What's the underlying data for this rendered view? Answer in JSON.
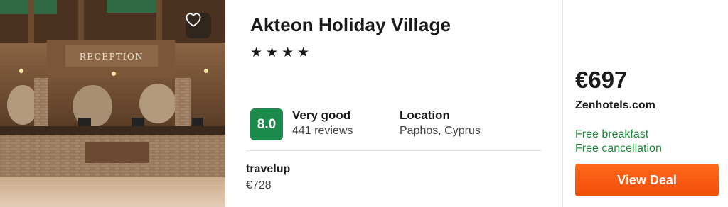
{
  "hotel": {
    "name": "Akteon Holiday Village",
    "star_count": 4,
    "stars": [
      "★",
      "★",
      "★",
      "★"
    ],
    "photo_sign": "RECEPTION",
    "favorite_icon": "heart-outline-icon"
  },
  "rating": {
    "score": "8.0",
    "label": "Very good",
    "reviews": "441 reviews",
    "badge_color": "#1c8a4b"
  },
  "location": {
    "label": "Location",
    "value": "Paphos, Cyprus"
  },
  "alternative_offer": {
    "provider": "travelup",
    "price": "€728"
  },
  "best_offer": {
    "price": "€697",
    "provider": "Zenhotels.com",
    "perks": [
      "Free breakfast",
      "Free cancellation"
    ],
    "perk_color": "#1e8a3c",
    "button_label": "View Deal",
    "button_color": "#f5500f"
  }
}
